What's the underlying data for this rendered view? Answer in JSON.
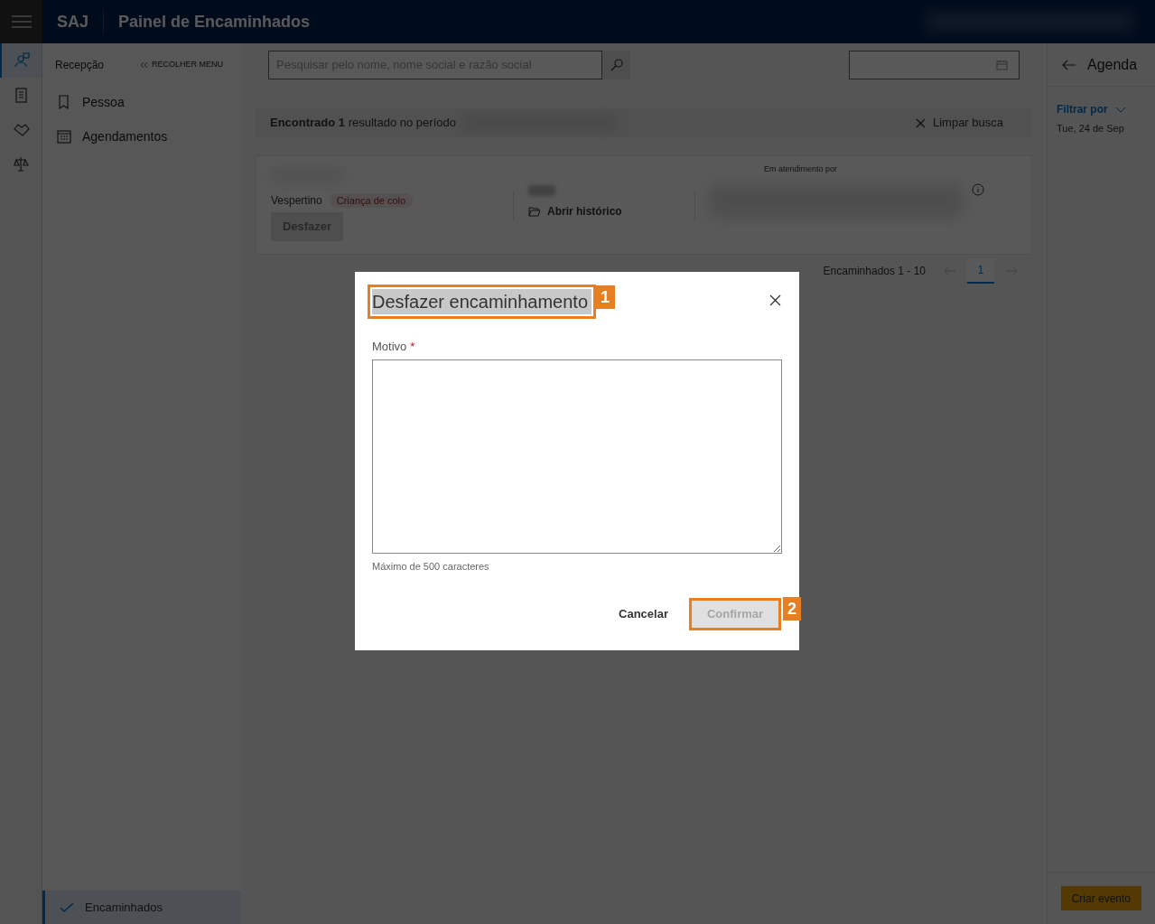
{
  "header": {
    "logo": "SAJ",
    "title": "Painel de Encaminhados"
  },
  "rail": [
    {
      "selected": true
    },
    {
      "selected": false
    },
    {
      "selected": false
    },
    {
      "selected": false
    }
  ],
  "side_menu": {
    "title": "Recepção",
    "collapse": "RECOLHER MENU",
    "items": [
      {
        "label": "Pessoa"
      },
      {
        "label": "Agendamentos"
      }
    ],
    "footer_item": {
      "label": "Encaminhados",
      "selected": true
    }
  },
  "search": {
    "placeholder": "Pesquisar pelo nome, nome social e razão social"
  },
  "results_bar": {
    "text": "**Encontrado 1** resultado no período",
    "clear": "Limpar busca"
  },
  "card": {
    "shift": "Vespertino",
    "tag": "Criança de colo",
    "undo": "Desfazer",
    "history": "Abrir histórico",
    "attending_label": "Em atendimento por"
  },
  "pagination": {
    "label": "Encaminhados 1 - 10",
    "pages": [
      {
        "label": "1",
        "selected": true
      }
    ]
  },
  "agenda": {
    "title": "Agenda",
    "filter": "Filtrar por",
    "date": "Tue, 24 de Sep",
    "create": "Criar evento"
  },
  "dialog": {
    "title": "Desfazer encaminhamento",
    "field_label": "Motivo",
    "required": true,
    "required_mark": "*",
    "hint": "Máximo de 500 caracteres",
    "cancel": "Cancelar",
    "confirm": "Confirmar",
    "confirm_disabled": true
  },
  "callouts": [
    {
      "label": "1"
    },
    {
      "label": "2"
    }
  ]
}
